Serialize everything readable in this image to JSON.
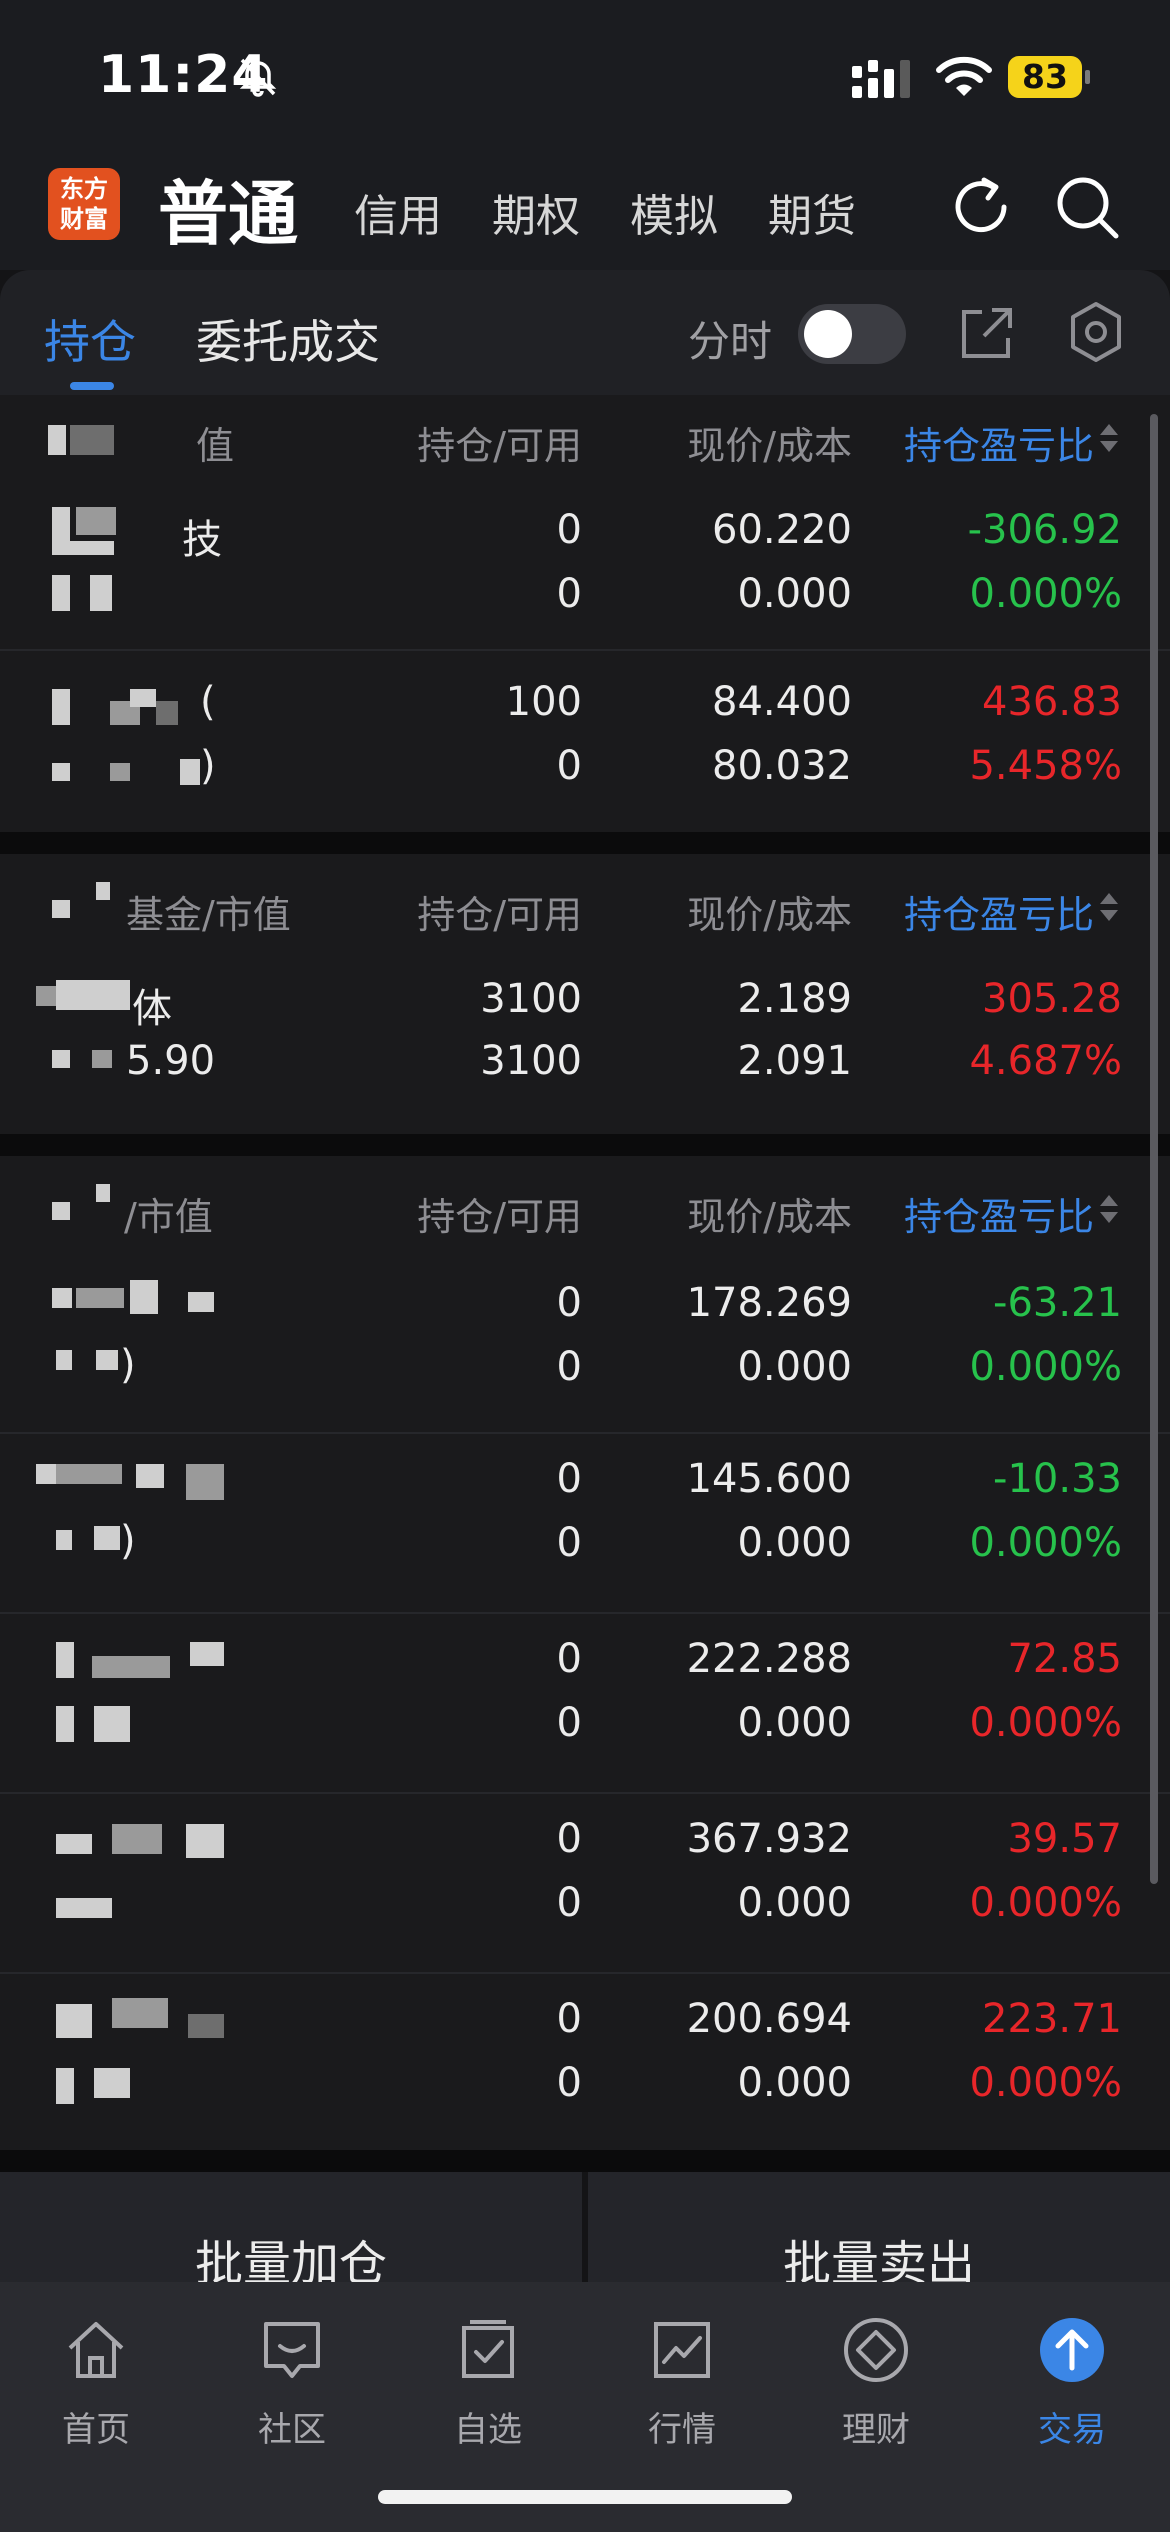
{
  "status_bar": {
    "time": "11:24",
    "battery": "83"
  },
  "account_bar": {
    "logo_line1": "东方",
    "logo_line2": "财富",
    "active": "普通",
    "tabs": [
      "信用",
      "期权",
      "模拟",
      "期货"
    ]
  },
  "sub_tabs": {
    "holdings": "持仓",
    "orders": "委托成交",
    "intraday_label": "分时"
  },
  "columns": {
    "position": "持仓/可用",
    "price": "现价/成本",
    "pl": "持仓盈亏比"
  },
  "sections": [
    {
      "name_header": "值",
      "rows": [
        {
          "name": "技",
          "pos": "0",
          "avail": "0",
          "price": "60.220",
          "cost": "0.000",
          "pl": "-306.92",
          "pl_pct": "0.000%",
          "dir": "down"
        },
        {
          "name": "(",
          "sub": ")",
          "pos": "100",
          "avail": "0",
          "price": "84.400",
          "cost": "80.032",
          "pl": "436.83",
          "pl_pct": "5.458%",
          "dir": "up"
        }
      ]
    },
    {
      "name_header": "基金/市值",
      "rows": [
        {
          "name": "体",
          "sub": "5.90",
          "pos": "3100",
          "avail": "3100",
          "price": "2.189",
          "cost": "2.091",
          "pl": "305.28",
          "pl_pct": "4.687%",
          "dir": "up"
        }
      ]
    },
    {
      "name_header": "/市值",
      "rows": [
        {
          "name": "",
          "sub": ")",
          "pos": "0",
          "avail": "0",
          "price": "178.269",
          "cost": "0.000",
          "pl": "-63.21",
          "pl_pct": "0.000%",
          "dir": "down"
        },
        {
          "name": "",
          "sub": ")",
          "pos": "0",
          "avail": "0",
          "price": "145.600",
          "cost": "0.000",
          "pl": "-10.33",
          "pl_pct": "0.000%",
          "dir": "down"
        },
        {
          "name": "",
          "pos": "0",
          "avail": "0",
          "price": "222.288",
          "cost": "0.000",
          "pl": "72.85",
          "pl_pct": "0.000%",
          "dir": "up"
        },
        {
          "name": "",
          "pos": "0",
          "avail": "0",
          "price": "367.932",
          "cost": "0.000",
          "pl": "39.57",
          "pl_pct": "0.000%",
          "dir": "up"
        },
        {
          "name": "",
          "pos": "0",
          "avail": "0",
          "price": "200.694",
          "cost": "0.000",
          "pl": "223.71",
          "pl_pct": "0.000%",
          "dir": "up"
        }
      ]
    }
  ],
  "batch": {
    "add": "批量加仓",
    "sell": "批量卖出"
  },
  "nav": [
    {
      "label": "首页",
      "icon": "home-icon"
    },
    {
      "label": "社区",
      "icon": "community-icon"
    },
    {
      "label": "自选",
      "icon": "watchlist-icon"
    },
    {
      "label": "行情",
      "icon": "market-icon"
    },
    {
      "label": "理财",
      "icon": "wealth-icon"
    },
    {
      "label": "交易",
      "icon": "trade-icon"
    }
  ],
  "colors": {
    "accent": "#3b86e6",
    "up": "#e8262a",
    "down": "#27c24c",
    "logo": "#e2511f"
  }
}
